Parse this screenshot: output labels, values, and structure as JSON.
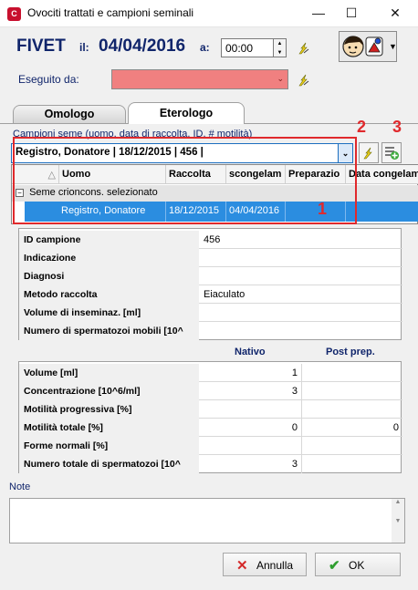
{
  "window": {
    "title": "Ovociti trattati e campioni seminali",
    "minimize": "—",
    "maximize": "☐",
    "close": "✕"
  },
  "header": {
    "program": "FIVET",
    "il_label": "il:",
    "date": "04/04/2016",
    "a_label": "a:",
    "time": "00:00",
    "eseguito_label": "Eseguito da:",
    "eseguito_value": "",
    "colors": {
      "navy": "#10256b",
      "required": "#f08080",
      "annotation": "#e0292c",
      "selection": "#2b8de0"
    }
  },
  "tabs": [
    {
      "label": "Omologo",
      "active": false
    },
    {
      "label": "Eterologo",
      "active": true
    }
  ],
  "campioni": {
    "label": "Campioni seme (uomo, data di raccolta, ID, # motilità)",
    "selected": "Registro, Donatore | 18/12/2015 | 456 |",
    "columns": [
      "Uomo",
      "Raccolta",
      "scongelam",
      "Preparazio",
      "Data congelam"
    ],
    "group": "Seme crioncons. selezionato",
    "rows": [
      {
        "uomo": "Registro, Donatore",
        "raccolta": "18/12/2015",
        "scongelam": "04/04/2016",
        "preparazione": "",
        "data_congelam": ""
      }
    ],
    "annotations": {
      "one": "1",
      "two": "2",
      "three": "3"
    }
  },
  "details": [
    {
      "label": "ID campione",
      "value": "456"
    },
    {
      "label": "Indicazione",
      "value": ""
    },
    {
      "label": "Diagnosi",
      "value": ""
    },
    {
      "label": "Metodo raccolta",
      "value": "Eiaculato"
    },
    {
      "label": "Volume di inseminaz. [ml]",
      "value": ""
    },
    {
      "label": "Numero di spermatozoi mobili [10^",
      "value": ""
    }
  ],
  "params": {
    "col_nativo": "Nativo",
    "col_post": "Post prep.",
    "rows": [
      {
        "label": "Volume [ml]",
        "nativo": "1",
        "post": ""
      },
      {
        "label": "Concentrazione [10^6/ml]",
        "nativo": "3",
        "post": ""
      },
      {
        "label": "Motilità progressiva [%]",
        "nativo": "",
        "post": ""
      },
      {
        "label": "Motilità totale [%]",
        "nativo": "0",
        "post": "0"
      },
      {
        "label": "Forme normali [%]",
        "nativo": "",
        "post": ""
      },
      {
        "label": "Numero totale di spermatozoi [10^",
        "nativo": "3",
        "post": ""
      }
    ]
  },
  "note": {
    "label": "Note",
    "value": ""
  },
  "buttons": {
    "annulla": "Annulla",
    "ok": "OK"
  }
}
